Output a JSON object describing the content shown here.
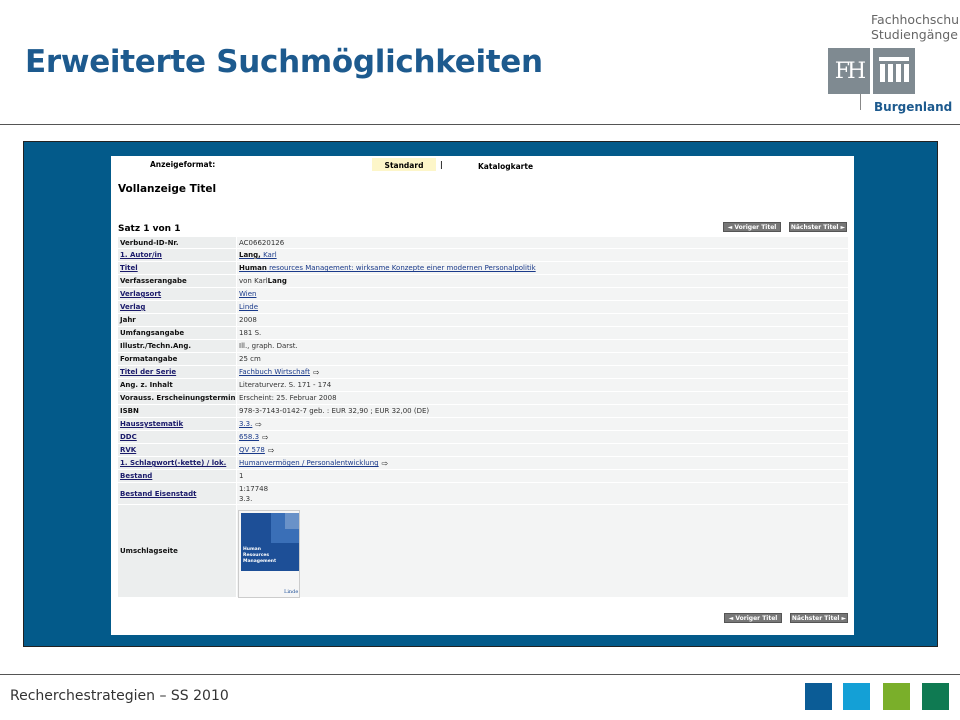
{
  "slide": {
    "title": "Erweiterte Suchmöglichkeiten",
    "footer": "Recherchestrategien – SS 2010",
    "footer_squares": [
      "#0b5c96",
      "#14a0d6",
      "#7aaf2a",
      "#0f7a52"
    ]
  },
  "logo": {
    "line1": "Fachhochschul",
    "line2": "Studiengänge",
    "mark": "FH",
    "place": "Burgenland"
  },
  "catalog": {
    "format_label": "Anzeigeformat:",
    "format_standard": "Standard",
    "format_separator": "|",
    "format_katalogkarte": "Katalogkarte",
    "heading": "Vollanzeige Titel",
    "record_counter": "Satz 1 von 1",
    "prev_button": "◄ Voriger Titel",
    "next_button": "Nächster Titel ►",
    "cover_title": "Human Resources Management",
    "cover_publisher": "Linde",
    "fields": [
      {
        "key": "Verbund-ID-Nr.",
        "value": "AC06620126"
      },
      {
        "key": "1. Autor/in",
        "value_bold": "Lang,",
        "value": " Karl"
      },
      {
        "key": "Titel",
        "value_bold": "Human",
        "value": " resources Management: wirksame Konzepte einer modernen Personalpolitik"
      },
      {
        "key": "Verfasserangabe",
        "value": "von Karl ",
        "value_bold_after": "Lang"
      },
      {
        "key": "Verlagsort",
        "value": "Wien"
      },
      {
        "key": "Verlag",
        "value": "Linde"
      },
      {
        "key": "Jahr",
        "value": "2008"
      },
      {
        "key": "Umfangsangabe",
        "value": "181 S."
      },
      {
        "key": "Illustr./Techn.Ang.",
        "value": "Ill., graph. Darst."
      },
      {
        "key": "Formatangabe",
        "value": "25 cm"
      },
      {
        "key": "Titel der Serie",
        "value": "Fachbuch Wirtschaft"
      },
      {
        "key": "Ang. z. Inhalt",
        "value": "Literaturverz. S. 171 - 174"
      },
      {
        "key": "Vorauss. Erscheinungstermin",
        "value": "Erscheint: 25. Februar 2008"
      },
      {
        "key": "ISBN",
        "value": "978-3-7143-0142-7 geb. : EUR 32,90 ; EUR 32,00 (DE)"
      },
      {
        "key": "Haussystematik",
        "value": "3.3."
      },
      {
        "key": "DDC",
        "value": "658.3"
      },
      {
        "key": "RVK",
        "value": "QV 578"
      },
      {
        "key": "1. Schlagwort(-kette) / lok.",
        "value": "Humanvermögen / Personalentwicklung"
      },
      {
        "key": "Bestand",
        "value": "1"
      },
      {
        "key": "Bestand Eisenstadt",
        "value": "1:17748",
        "value2": "3.3."
      },
      {
        "key": "Umschlagseite",
        "value": ""
      }
    ]
  }
}
